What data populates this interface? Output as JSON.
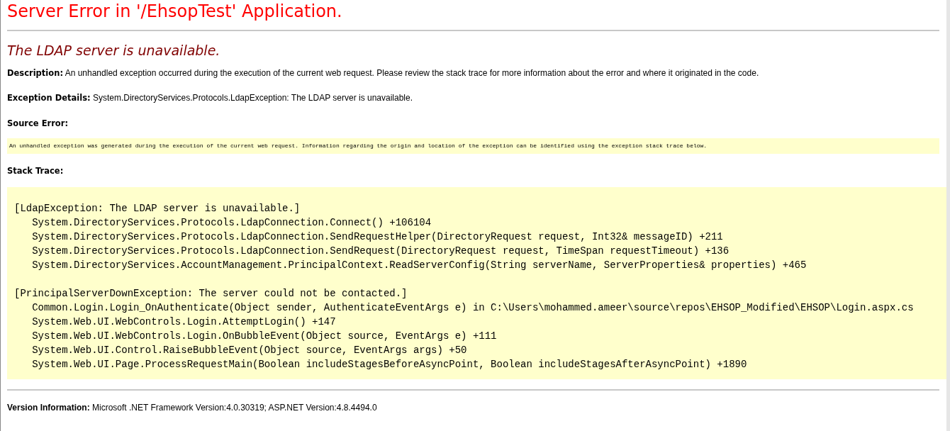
{
  "title": "Server Error in '/EhsopTest' Application.",
  "heading": "The LDAP server is unavailable.",
  "description": {
    "label": "Description:",
    "text": "An unhandled exception occurred during the execution of the current web request. Please review the stack trace for more information about the error and where it originated in the code."
  },
  "exception_details": {
    "label": "Exception Details:",
    "text": "System.DirectoryServices.Protocols.LdapException: The LDAP server is unavailable."
  },
  "source_error": {
    "label": "Source Error:",
    "text": "An unhandled exception was generated during the execution of the current web request. Information regarding the origin and location of the exception can be identified using the exception stack trace below."
  },
  "stack_trace": {
    "label": "Stack Trace:",
    "blocks": [
      {
        "header": "[LdapException: The LDAP server is unavailable.]",
        "frames": [
          "System.DirectoryServices.Protocols.LdapConnection.Connect() +106104",
          "System.DirectoryServices.Protocols.LdapConnection.SendRequestHelper(DirectoryRequest request, Int32& messageID) +211",
          "System.DirectoryServices.Protocols.LdapConnection.SendRequest(DirectoryRequest request, TimeSpan requestTimeout) +136",
          "System.DirectoryServices.AccountManagement.PrincipalContext.ReadServerConfig(String serverName, ServerProperties& properties) +465"
        ]
      },
      {
        "header": "[PrincipalServerDownException: The server could not be contacted.]",
        "frames": [
          "Common.Login.Login_OnAuthenticate(Object sender, AuthenticateEventArgs e) in C:\\Users\\mohammed.ameer\\source\\repos\\EHSOP_Modified\\EHSOP\\Login.aspx.cs",
          "System.Web.UI.WebControls.Login.AttemptLogin() +147",
          "System.Web.UI.WebControls.Login.OnBubbleEvent(Object source, EventArgs e) +111",
          "System.Web.UI.Control.RaiseBubbleEvent(Object source, EventArgs args) +50",
          "System.Web.UI.Page.ProcessRequestMain(Boolean includeStagesBeforeAsyncPoint, Boolean includeStagesAfterAsyncPoint) +1890"
        ]
      }
    ]
  },
  "version": {
    "label": "Version Information:",
    "text": "Microsoft .NET Framework Version:4.0.30319; ASP.NET Version:4.8.4494.0"
  }
}
